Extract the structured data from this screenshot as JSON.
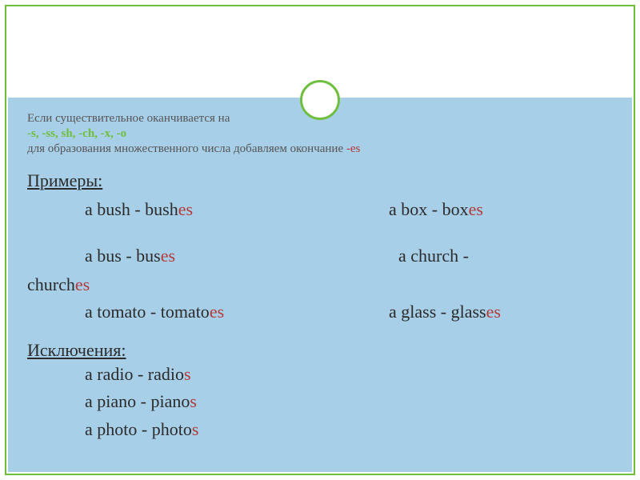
{
  "rule": {
    "line1": "Если существительное оканчивается на",
    "endings": "-s, -ss, sh, -ch, -x, -o",
    "line3_prefix": "для образования множественного числа добавляем окончание  ",
    "line3_suffix": "-es"
  },
  "examples_label": "Примеры:",
  "examples": {
    "row1": {
      "left": {
        "singular": "a bush",
        "dash": "  -  ",
        "plural_stem": "bush",
        "plural_suffix": "es"
      },
      "right": {
        "singular": "a box",
        "dash": "  -  ",
        "plural_stem": "box",
        "plural_suffix": "es"
      }
    },
    "row2": {
      "left": {
        "singular": "a bus",
        "dash": "  -  ",
        "plural_stem": "bus",
        "plural_suffix": "es"
      },
      "right_text": "a church  -  ",
      "right_wrap_stem": "church",
      "right_wrap_suffix": "es"
    },
    "row3": {
      "left": {
        "singular": "a tomato",
        "dash": "  -  ",
        "plural_stem": "tomato",
        "plural_suffix": "es"
      },
      "right": {
        "singular": "a glass",
        "dash": "  -  ",
        "plural_stem": "glass",
        "plural_suffix": "es"
      }
    }
  },
  "exceptions_label": "Исключения:",
  "exceptions": [
    {
      "singular": "a radio",
      "dash": "  -  ",
      "plural_stem": "radio",
      "plural_suffix": "s"
    },
    {
      "singular": "a piano",
      "dash": "  -  ",
      "plural_stem": "piano",
      "plural_suffix": "s"
    },
    {
      "singular": "a photo",
      "dash": "  -  ",
      "plural_stem": "photo",
      "plural_suffix": "s"
    }
  ]
}
